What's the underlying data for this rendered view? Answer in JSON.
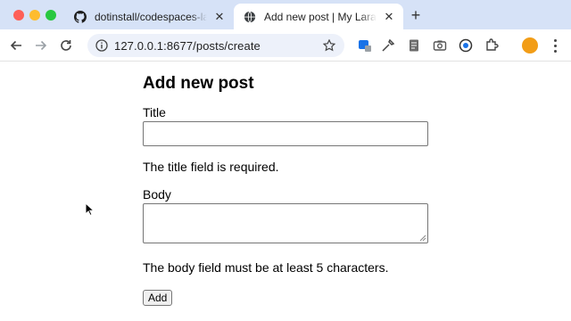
{
  "browser": {
    "tabs": [
      {
        "title": "dotinstall/codespaces-laravel",
        "favicon": "github-icon"
      },
      {
        "title": "Add new post | My Laravel App",
        "favicon": "globe-icon",
        "active": true
      }
    ],
    "url": "127.0.0.1:8677/posts/create"
  },
  "page": {
    "heading": "Add new post",
    "form": {
      "title_label": "Title",
      "title_value": "",
      "title_error": "The title field is required.",
      "body_label": "Body",
      "body_value": "",
      "body_error": "The body field must be at least 5 characters.",
      "submit_label": "Add"
    }
  },
  "colors": {
    "tabstrip": "#d6e2f7",
    "omnibox": "#edf1fa",
    "profile": "#f29d17"
  }
}
